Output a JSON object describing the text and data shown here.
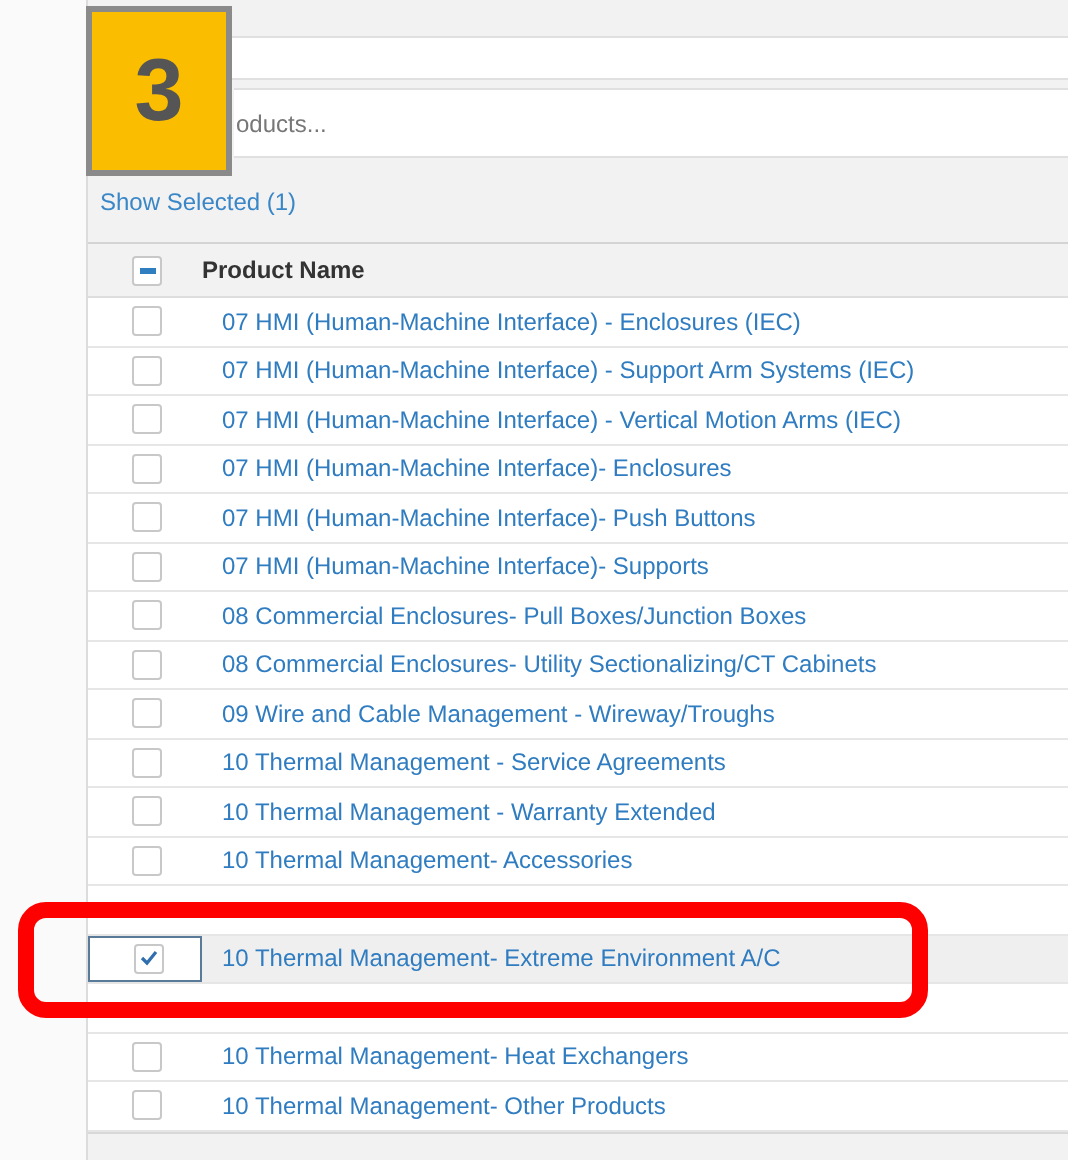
{
  "step_badge": "3",
  "search": {
    "placeholder": "oducts..."
  },
  "show_selected_link": "Show Selected (1)",
  "table": {
    "header": {
      "label": "Product Name",
      "partially_selected": true
    },
    "rows": [
      {
        "label": "07 HMI (Human-Machine Interface) - Enclosures (IEC)",
        "selected": false
      },
      {
        "label": "07 HMI (Human-Machine Interface) - Support Arm Systems (IEC)",
        "selected": false
      },
      {
        "label": "07 HMI (Human-Machine Interface) - Vertical Motion Arms (IEC)",
        "selected": false
      },
      {
        "label": "07 HMI (Human-Machine Interface)- Enclosures",
        "selected": false
      },
      {
        "label": "07 HMI (Human-Machine Interface)- Push Buttons",
        "selected": false
      },
      {
        "label": "07 HMI (Human-Machine Interface)- Supports",
        "selected": false
      },
      {
        "label": "08 Commercial Enclosures- Pull Boxes/Junction Boxes",
        "selected": false
      },
      {
        "label": "08 Commercial Enclosures- Utility Sectionalizing/CT Cabinets",
        "selected": false
      },
      {
        "label": "09 Wire and Cable Management - Wireway/Troughs",
        "selected": false
      },
      {
        "label": "10 Thermal Management - Service Agreements",
        "selected": false
      },
      {
        "label": "10 Thermal Management - Warranty Extended",
        "selected": false
      },
      {
        "label": "10 Thermal Management- Accessories",
        "selected": false
      },
      {
        "kind": "covered"
      },
      {
        "label": "10 Thermal Management- Extreme Environment A/C",
        "selected": true,
        "highlighted": true
      },
      {
        "kind": "covered"
      },
      {
        "label": "10 Thermal Management- Heat Exchangers",
        "selected": false
      },
      {
        "label": "10 Thermal Management- Other Products",
        "selected": false
      }
    ]
  }
}
